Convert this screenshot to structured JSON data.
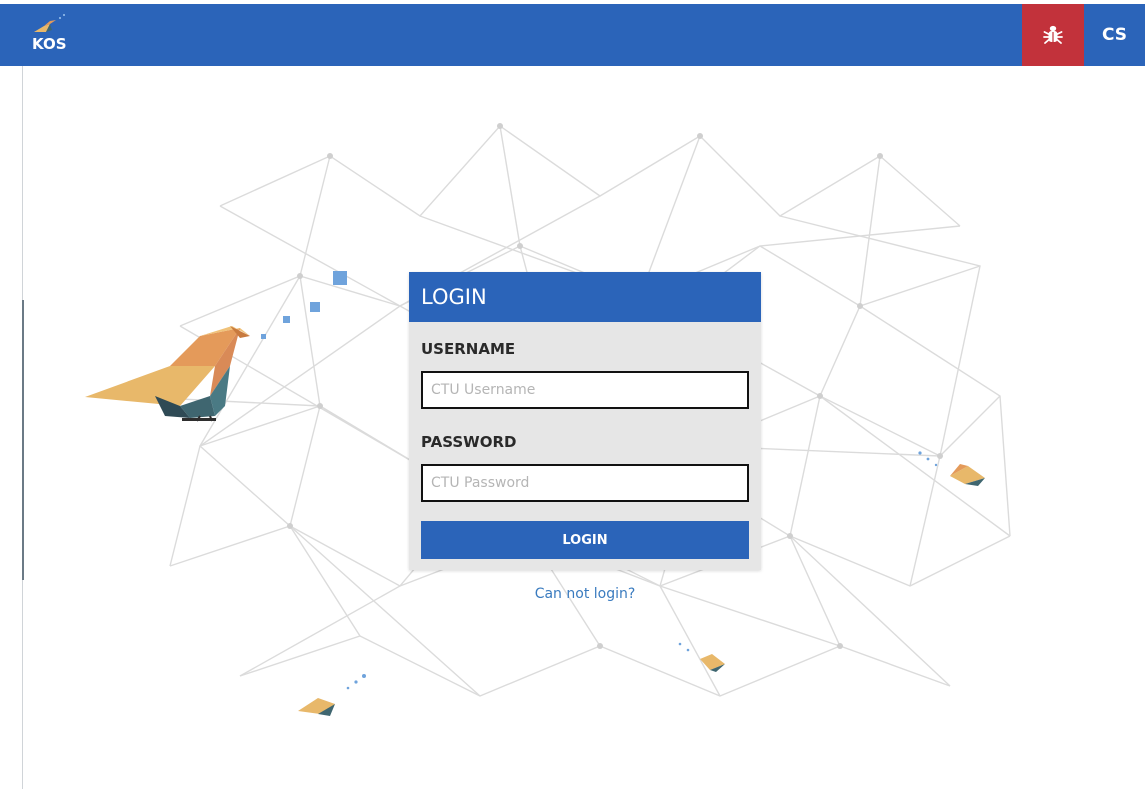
{
  "header": {
    "logo_text": "KOS",
    "report_bug_icon": "bug-icon",
    "language_label": "CS"
  },
  "login": {
    "title": "LOGIN",
    "username_label": "USERNAME",
    "username_placeholder": "CTU Username",
    "password_label": "PASSWORD",
    "password_placeholder": "CTU Password",
    "submit_label": "LOGIN",
    "help_link": "Can not login?"
  },
  "colors": {
    "brand_blue": "#2b64b9",
    "bug_red": "#c2323b",
    "link_blue": "#3a7bbf"
  }
}
